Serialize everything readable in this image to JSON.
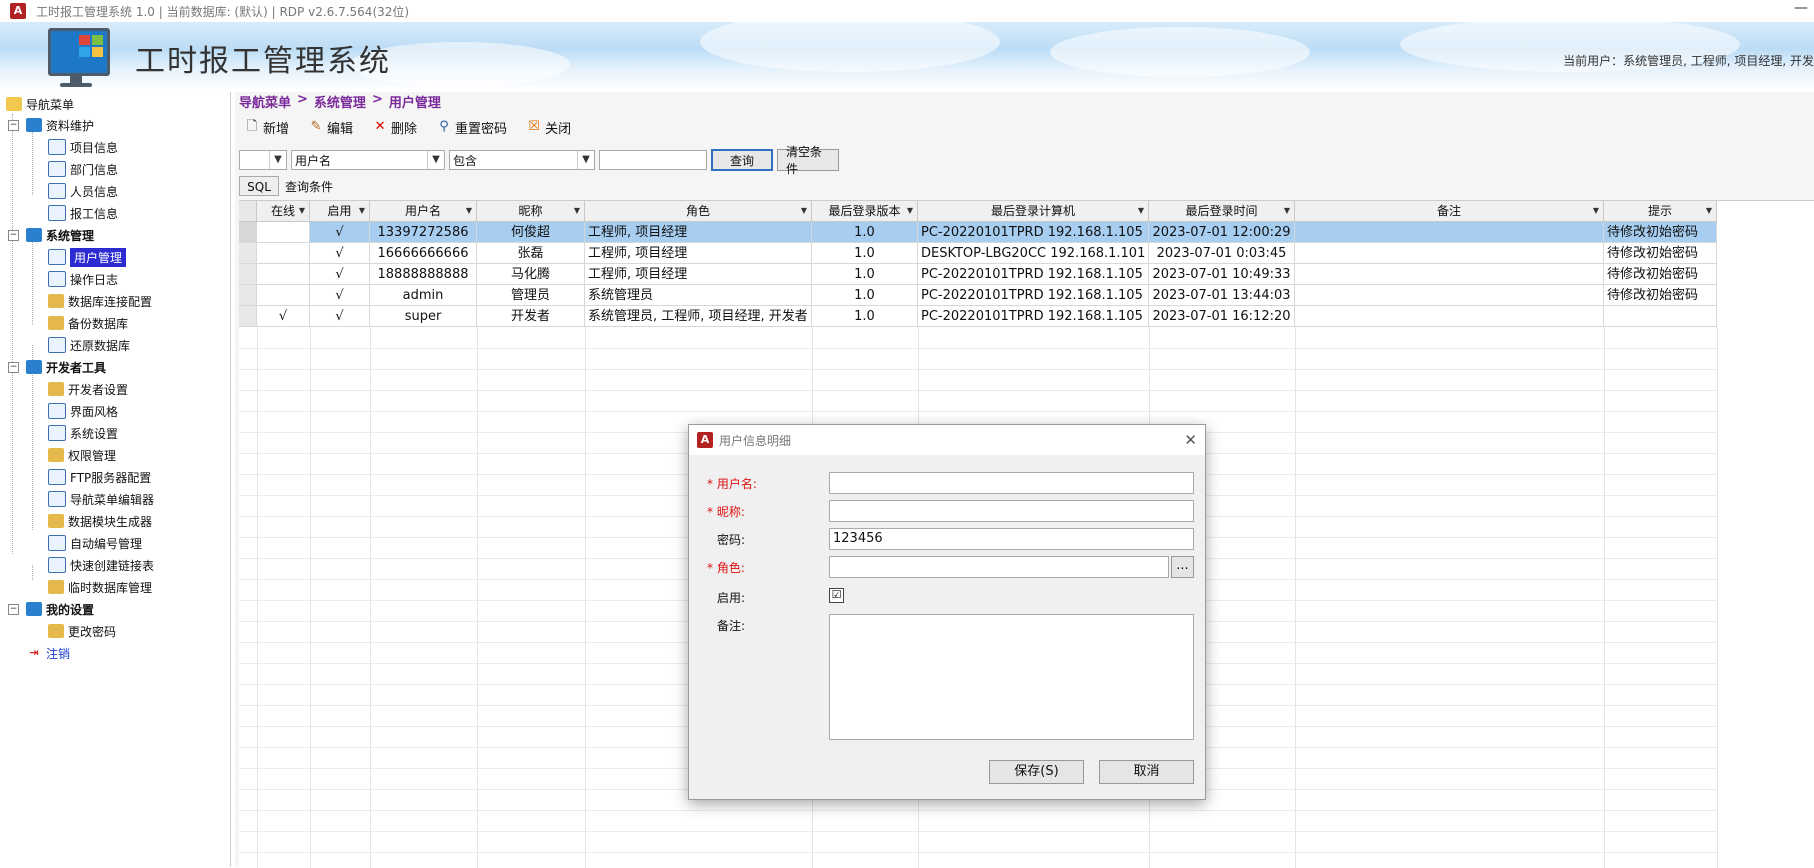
{
  "window": {
    "title": "工时报工管理系统 1.0 | 当前数据库: (默认) | RDP v2.6.7.564(32位)",
    "app_icon_letter": "A",
    "minimize_glyph": "—"
  },
  "header": {
    "app_title": "工时报工管理系统",
    "current_user": "当前用户：系统管理员, 工程师, 项目经理, 开发"
  },
  "sidebar": {
    "root_label": "导航菜单",
    "groups": [
      {
        "label": "资料维护",
        "items": [
          "项目信息",
          "部门信息",
          "人员信息",
          "报工信息"
        ]
      },
      {
        "label": "系统管理",
        "items": [
          "用户管理",
          "操作日志",
          "数据库连接配置",
          "备份数据库",
          "还原数据库"
        ]
      },
      {
        "label": "开发者工具",
        "items": [
          "开发者设置",
          "界面风格",
          "系统设置",
          "权限管理",
          "FTP服务器配置",
          "导航菜单编辑器",
          "数据模块生成器",
          "自动编号管理",
          "快速创建链接表",
          "临时数据库管理"
        ]
      },
      {
        "label": "我的设置",
        "items": [
          "更改密码"
        ]
      }
    ],
    "logout_label": "注销",
    "selected_item": "用户管理"
  },
  "breadcrumb": {
    "items": [
      "导航菜单",
      "系统管理",
      "用户管理"
    ],
    "separator": ">"
  },
  "toolbar": {
    "add": "新增",
    "edit": "编辑",
    "delete": "删除",
    "reset_password": "重置密码",
    "close": "关闭"
  },
  "filter": {
    "paren_value": "",
    "field_value": "用户名",
    "operator_value": "包含",
    "keyword_value": "",
    "query_button": "查询",
    "clear_button": "清空条件"
  },
  "sql": {
    "tab_label": "SQL",
    "text": "查询条件"
  },
  "grid": {
    "columns": [
      "在线",
      "启用",
      "用户名",
      "昵称",
      "角色",
      "最后登录版本",
      "最后登录计算机",
      "最后登录时间",
      "备注",
      "提示"
    ],
    "rows": [
      {
        "online": "",
        "enabled": "√",
        "username": "13397272586",
        "nickname": "何俊超",
        "role": "工程师, 项目经理",
        "version": "1.0",
        "computer": "PC-20220101TPRD 192.168.1.105",
        "time": "2023-07-01 12:00:29",
        "note": "",
        "hint": "待修改初始密码"
      },
      {
        "online": "",
        "enabled": "√",
        "username": "16666666666",
        "nickname": "张磊",
        "role": "工程师, 项目经理",
        "version": "1.0",
        "computer": "DESKTOP-LBG20CC 192.168.1.101",
        "time": "2023-07-01 0:03:45",
        "note": "",
        "hint": "待修改初始密码"
      },
      {
        "online": "",
        "enabled": "√",
        "username": "18888888888",
        "nickname": "马化腾",
        "role": "工程师, 项目经理",
        "version": "1.0",
        "computer": "PC-20220101TPRD 192.168.1.105",
        "time": "2023-07-01 10:49:33",
        "note": "",
        "hint": "待修改初始密码"
      },
      {
        "online": "",
        "enabled": "√",
        "username": "admin",
        "nickname": "管理员",
        "role": "系统管理员",
        "version": "1.0",
        "computer": "PC-20220101TPRD 192.168.1.105",
        "time": "2023-07-01 13:44:03",
        "note": "",
        "hint": "待修改初始密码"
      },
      {
        "online": "√",
        "enabled": "√",
        "username": "super",
        "nickname": "开发者",
        "role": "系统管理员, 工程师, 项目经理, 开发者",
        "version": "1.0",
        "computer": "PC-20220101TPRD 192.168.1.105",
        "time": "2023-07-01 16:12:20",
        "note": "",
        "hint": ""
      }
    ],
    "selected_row": 0
  },
  "dialog": {
    "title": "用户信息明细",
    "close_glyph": "✕",
    "fields": {
      "username_label": "* 用户名:",
      "username_value": "",
      "nickname_label": "* 昵称:",
      "nickname_value": "",
      "password_label": "密码:",
      "password_value": "123456",
      "role_label": "* 角色:",
      "role_value": "",
      "role_browse": "...",
      "enabled_label": "启用:",
      "enabled_checked": "☑",
      "note_label": "备注:",
      "note_value": ""
    },
    "save_button": "保存(S)",
    "cancel_button": "取消"
  }
}
